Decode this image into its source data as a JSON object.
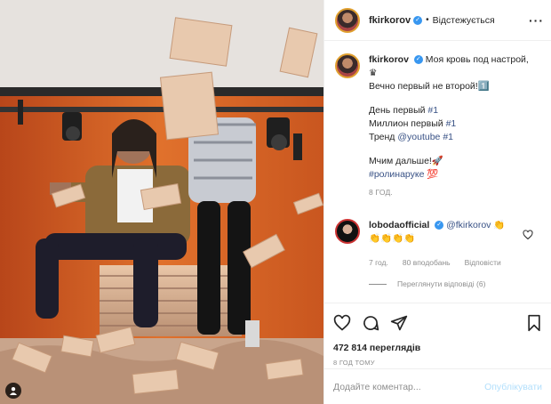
{
  "post": {
    "username": "fkirkorov",
    "follow_status": "Відстежується",
    "more_icon": "more-options-icon"
  },
  "caption": {
    "username": "fkirkorov",
    "line1": "Моя кровь под настрой,",
    "line1_emoji": "♛",
    "line2": "Вечно первый не второй!",
    "line2_emoji": "1️⃣",
    "line3_prefix": "День первый ",
    "line3_tag": "#1",
    "line4_prefix": "Миллион первый ",
    "line4_tag": "#1",
    "line5_prefix": "Тренд ",
    "line5_mention": "@youtube",
    "line5_tag": "#1",
    "line6": "Мчим дальше!",
    "line6_emoji": "🚀",
    "line7_tag": "#ролинаруке",
    "line7_emoji": "💯",
    "time": "8 год."
  },
  "comment": {
    "username": "lobodaofficial",
    "mention": "@fkirkorov",
    "text": "👏👏👏👏👏",
    "time": "7 год.",
    "likes": "80 вподобань",
    "reply": "Відповісти",
    "view_replies": "Переглянути відповіді (6)"
  },
  "actions": {
    "views": "472 814 переглядів",
    "posted_ago": "8 год тому"
  },
  "add_comment": {
    "placeholder": "Додайте коментар...",
    "publish": "Опублікувати"
  },
  "colors": {
    "accent_blue": "#3897f0",
    "link": "#385185",
    "muted": "#8e8e8e",
    "publish_disabled": "#b2dffc"
  }
}
